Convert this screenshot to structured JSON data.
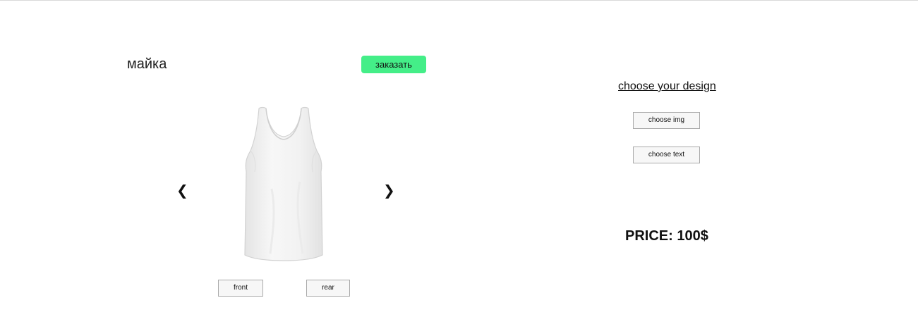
{
  "product": {
    "title": "майка",
    "order_label": "заказать"
  },
  "carousel": {
    "prev_glyph": "❮",
    "next_glyph": "❯",
    "image_icon": "tank-top-image"
  },
  "view_buttons": {
    "front_label": "front",
    "rear_label": "rear"
  },
  "design": {
    "link_text": "choose your design",
    "choose_img_label": "choose img",
    "choose_text_label": "choose text"
  },
  "price": {
    "text": "PRICE: 100$"
  },
  "colors": {
    "order_button": "#44ee88",
    "button_bg": "#f7f7f7",
    "button_border": "#a9a9a9"
  }
}
